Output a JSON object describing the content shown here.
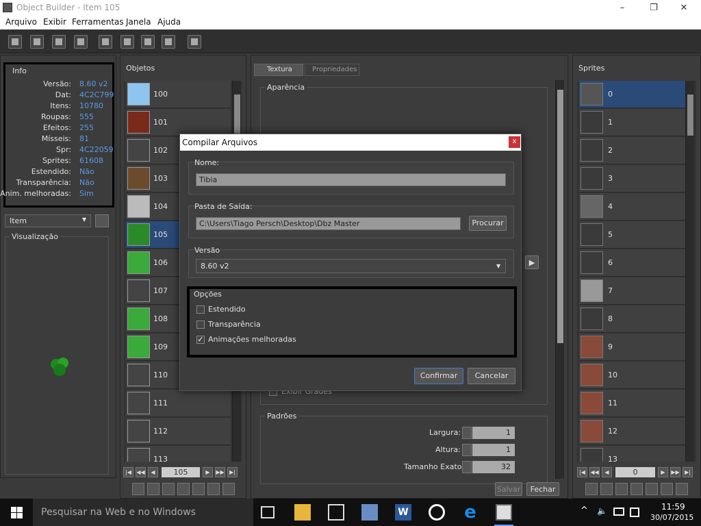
{
  "window": {
    "title": "Object Builder - Item 105",
    "controls": [
      "–",
      "❐",
      "✕"
    ]
  },
  "menu": [
    "Arquivo",
    "Exibir",
    "Ferramentas",
    "Janela",
    "Ajuda"
  ],
  "info": {
    "title": "Info",
    "rows": [
      {
        "label": "Versão:",
        "value": "8.60 v2"
      },
      {
        "label": "Dat:",
        "value": "4C2C799"
      },
      {
        "label": "Itens:",
        "value": "10780"
      },
      {
        "label": "Roupas:",
        "value": "555"
      },
      {
        "label": "Efeitos:",
        "value": "255"
      },
      {
        "label": "Mísseis:",
        "value": "81"
      },
      {
        "label": "Spr:",
        "value": "4C22059"
      },
      {
        "label": "Sprites:",
        "value": "61608"
      },
      {
        "label": "Estendido:",
        "value": "Não"
      },
      {
        "label": "Transparência:",
        "value": "Não"
      },
      {
        "label": "Anim. melhoradas:",
        "value": "Sim"
      }
    ]
  },
  "category": {
    "selected": "Item"
  },
  "preview": {
    "title": "Visualização"
  },
  "objects": {
    "title": "Objetos",
    "items": [
      "100",
      "101",
      "102",
      "103",
      "104",
      "105",
      "106",
      "107",
      "108",
      "109",
      "110",
      "111",
      "112",
      "113"
    ],
    "selected": "105",
    "page": "105"
  },
  "tabs": [
    {
      "label": "Textura",
      "active": true
    },
    {
      "label": "Propriedades",
      "active": false
    }
  ],
  "appearance": {
    "title": "Aparência",
    "show_grid": "Exibir Grades"
  },
  "defaults": {
    "title": "Padrões",
    "fields": [
      {
        "label": "Largura:",
        "value": "1"
      },
      {
        "label": "Altura:",
        "value": "1"
      },
      {
        "label": "Tamanho Exato:",
        "value": "32"
      }
    ]
  },
  "footer": {
    "save": "Salvar",
    "close": "Fechar"
  },
  "sprites": {
    "title": "Sprites",
    "items": [
      "0",
      "1",
      "2",
      "3",
      "4",
      "5",
      "6",
      "7",
      "8",
      "9",
      "10",
      "11",
      "12",
      "13"
    ],
    "selected": "0",
    "page": "0"
  },
  "dialog": {
    "title": "Compilar Arquivos",
    "name_label": "Nome:",
    "name_value": "Tibia",
    "output_label": "Pasta de Saída:",
    "output_value": "C:\\Users\\Tiago Persch\\Desktop\\Dbz Master",
    "browse": "Procurar",
    "version_label": "Versão",
    "version_value": "8.60 v2",
    "options_label": "Opções",
    "options": [
      {
        "label": "Estendido",
        "checked": false
      },
      {
        "label": "Transparência",
        "checked": false
      },
      {
        "label": "Animações melhoradas",
        "checked": true
      }
    ],
    "confirm": "Confirmar",
    "cancel": "Cancelar"
  },
  "taskbar": {
    "search_placeholder": "Pesquisar na Web e no Windows",
    "time": "11:59",
    "date": "30/07/2015"
  },
  "colors": {
    "accent": "#5a9be6",
    "selection": "#2a4a78",
    "dialog_title_bg": "#ffffff",
    "close_red": "#c8333a"
  }
}
